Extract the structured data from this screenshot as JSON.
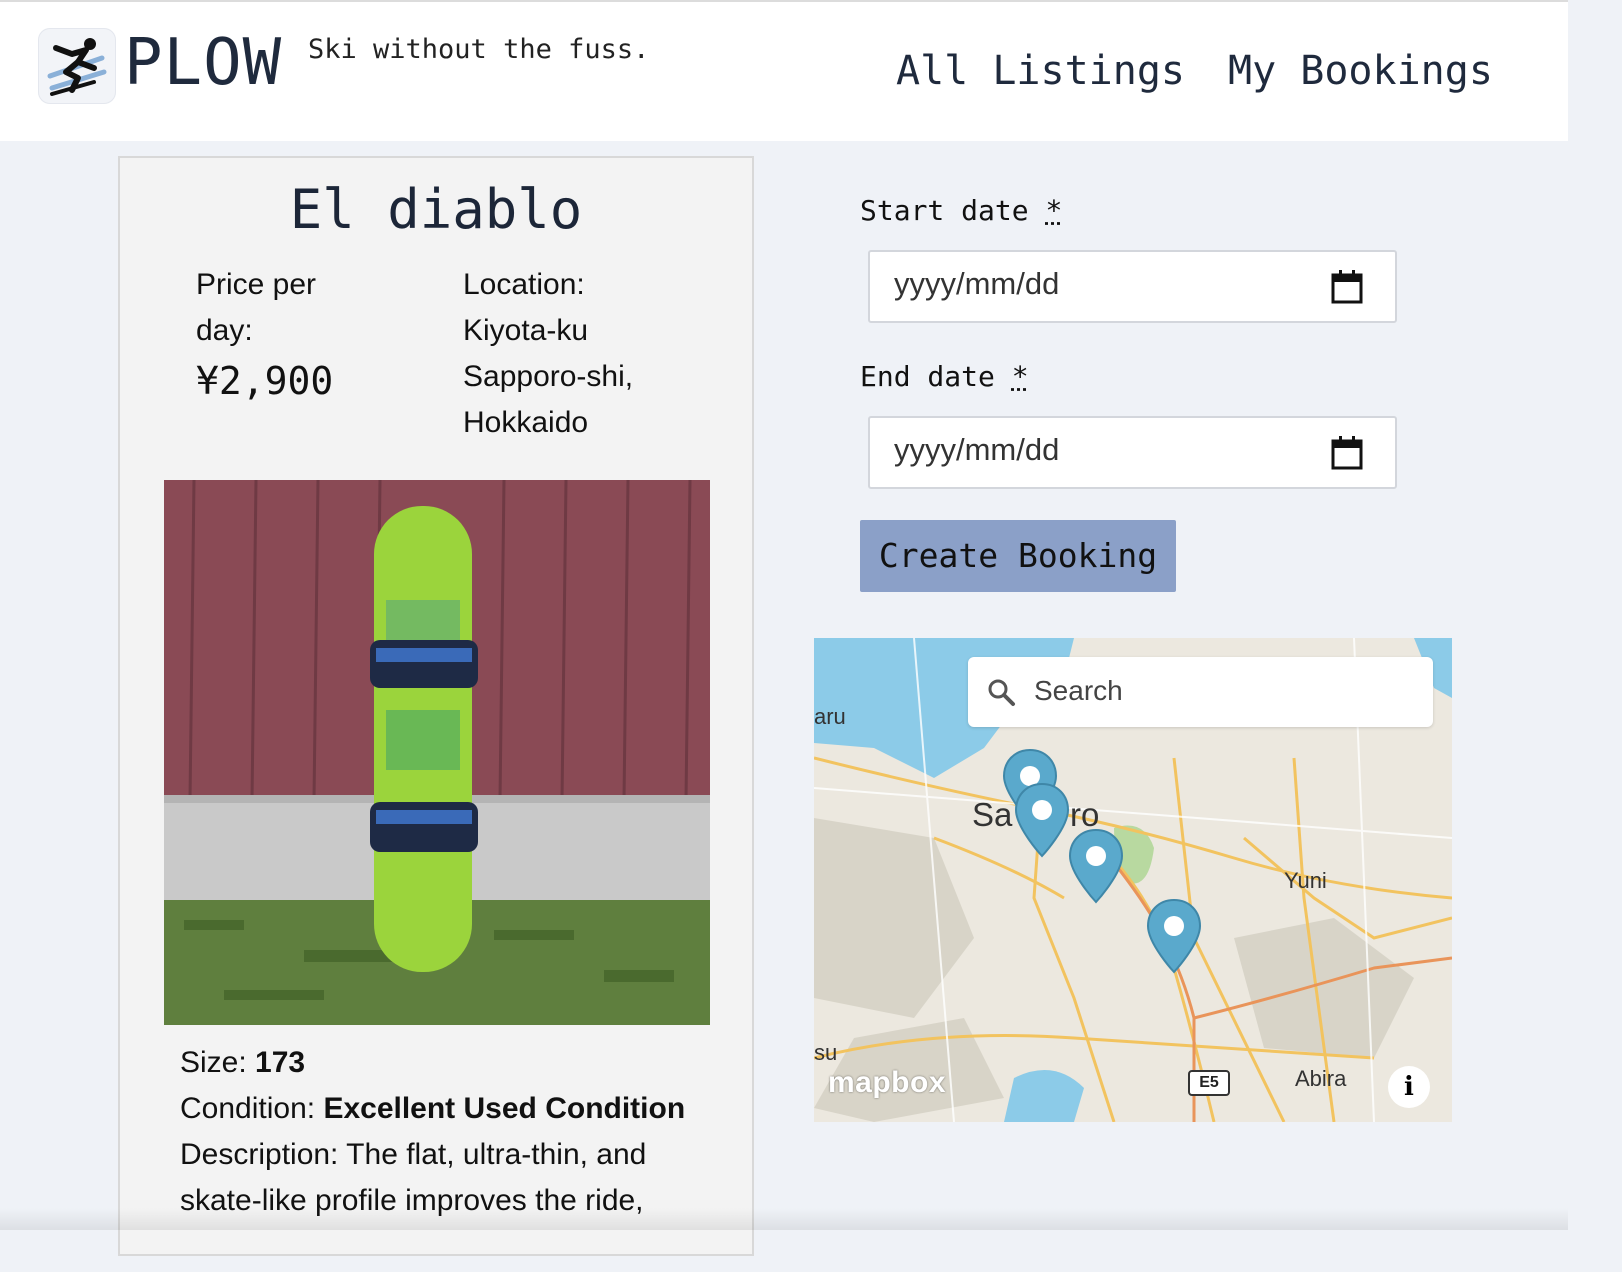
{
  "header": {
    "brand": "PLOW",
    "tagline": "Ski without the fuss.",
    "nav": [
      "All Listings",
      "My Bookings"
    ]
  },
  "listing": {
    "title": "El diablo",
    "price_label_line1": "Price per",
    "price_label_line2": "day:",
    "price": "¥2,900",
    "location_label": "Location:",
    "location_lines": [
      "Kiyota-ku",
      "Sapporo-shi,",
      "Hokkaido"
    ],
    "size_label": "Size: ",
    "size_value": "173",
    "condition_label": "Condition: ",
    "condition_value": "Excellent Used Condition",
    "description_line1": "Description: The flat, ultra-thin, and",
    "description_line2": "skate-like profile improves the ride,"
  },
  "booking": {
    "start_label": "Start date",
    "end_label": "End date",
    "required_marker": "*",
    "start_placeholder": "yyyy/mm/dd",
    "end_placeholder": "yyyy/mm/dd",
    "submit_label": "Create Booking"
  },
  "map": {
    "search_placeholder": "Search",
    "labels": {
      "aru": "aru",
      "sapporo_left": "Sa",
      "sapporo_right": "ro",
      "yuni": "Yuni",
      "su": "su",
      "abira": "Abira",
      "e5": "E5"
    },
    "attribution": "mapbox",
    "info_glyph": "i",
    "marker_color": "#5aa9cc",
    "water_color": "#8ccbe8"
  }
}
